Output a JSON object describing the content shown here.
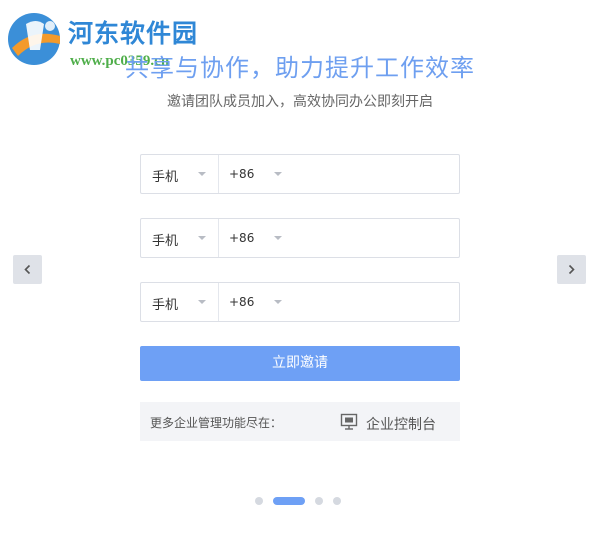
{
  "watermark": {
    "title": "河东软件园",
    "url": "www.pc0359.cn"
  },
  "header": {
    "title": "共享与协作，助力提升工作效率",
    "subtitle": "邀请团队成员加入，高效协同办公即刻开启"
  },
  "invite_rows": [
    {
      "type_label": "手机",
      "country_code": "+86",
      "number_value": ""
    },
    {
      "type_label": "手机",
      "country_code": "+86",
      "number_value": ""
    },
    {
      "type_label": "手机",
      "country_code": "+86",
      "number_value": ""
    }
  ],
  "invite_button_label": "立即邀请",
  "info": {
    "text": "更多企业管理功能尽在：",
    "console_label": "企业控制台",
    "console_icon": "monitor-icon"
  },
  "carousel": {
    "slide_count": 4,
    "active_index": 1
  },
  "colors": {
    "accent": "#6ea0f5",
    "watermark_blue": "#2f87d6",
    "watermark_green": "#4fae4a"
  }
}
